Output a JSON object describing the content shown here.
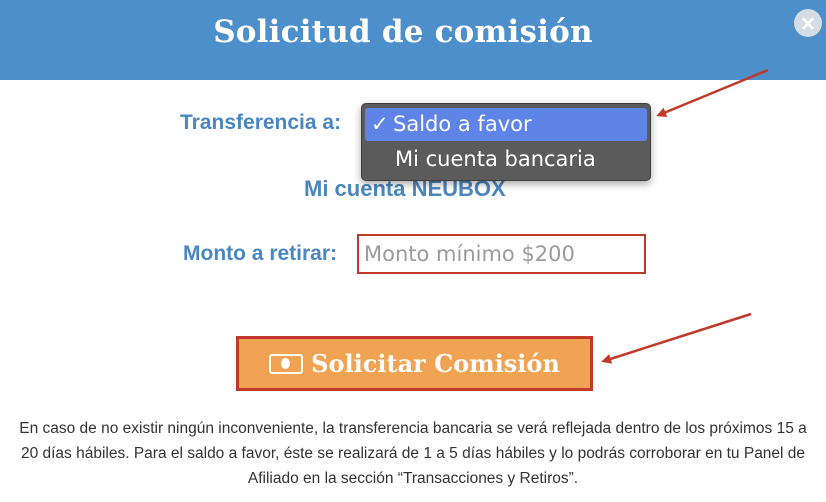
{
  "dialog": {
    "title": "Solicitud de comisión",
    "close_symbol": "×"
  },
  "transfer": {
    "label": "Transferencia a:",
    "options": [
      {
        "label": "Saldo a favor",
        "selected": true,
        "check": "✓"
      },
      {
        "label": "Mi cuenta bancaria",
        "selected": false
      }
    ]
  },
  "account": {
    "text": "Mi cuenta NEUBOX"
  },
  "amount": {
    "label": "Monto a retirar:",
    "placeholder": "Monto mínimo $200"
  },
  "submit": {
    "label": "Solicitar Comisión",
    "icon": "money-bill-icon"
  },
  "footer": {
    "text": "En caso de no existir ningún inconveniente, la transferencia bancaria se verá reflejada dentro de los próximos 15 a 20 días hábiles. Para el saldo a favor, éste se realizará de 1 a 5 días hábiles y lo podrás corroborar en tu Panel de Afiliado en la sección “Transacciones y Retiros”."
  },
  "colors": {
    "header": "#4d8fcb",
    "label": "#4a87c0",
    "button": "#f0a353",
    "annotation": "#c0392b",
    "selected_option": "#5f84e8"
  }
}
